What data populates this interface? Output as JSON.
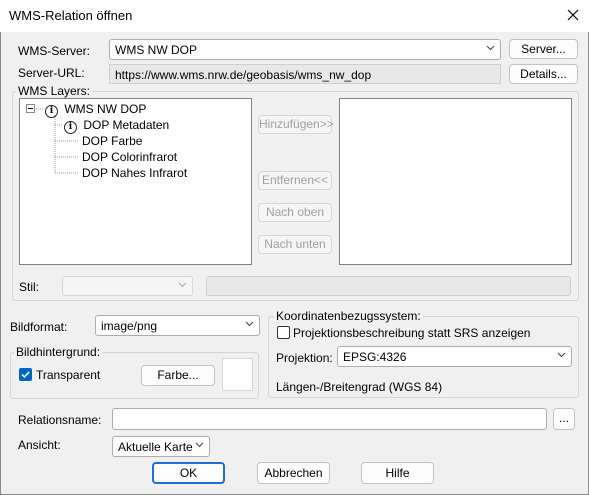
{
  "window": {
    "title": "WMS-Relation öffnen"
  },
  "server": {
    "label": "WMS-Server:",
    "value": "WMS NW DOP",
    "button": "Server...",
    "url_label": "Server-URL:",
    "url": "https://www.wms.nrw.de/geobasis/wms_nw_dop",
    "details_button": "Details..."
  },
  "layers": {
    "group_title": "WMS Layers:",
    "tree": {
      "root": "WMS NW DOP",
      "children": [
        "DOP Metadaten",
        "DOP Farbe",
        "DOP Colorinfrarot",
        "DOP Nahes Infrarot"
      ]
    },
    "add_button": "Hinzufügen>>",
    "remove_button": "Entfernen<<",
    "up_button": "Nach oben",
    "down_button": "Nach unten",
    "style_label": "Stil:"
  },
  "image": {
    "format_label": "Bildformat:",
    "format_value": "image/png",
    "background_title": "Bildhintergrund:",
    "transparent_label": "Transparent",
    "transparent_checked": true,
    "color_button": "Farbe..."
  },
  "crs": {
    "group_title": "Koordinatenbezugssystem:",
    "checkbox_label": "Projektionsbeschreibung statt SRS anzeigen",
    "projection_label": "Projektion:",
    "projection_value": "EPSG:4326",
    "description": "Längen-/Breitengrad (WGS 84)"
  },
  "relation": {
    "name_label": "Relationsname:",
    "name_value": "",
    "browse_button": "...",
    "view_label": "Ansicht:",
    "view_value": "Aktuelle Karte"
  },
  "footer": {
    "ok": "OK",
    "cancel": "Abbrechen",
    "help": "Hilfe"
  },
  "colors": {
    "accent": "#0067c0",
    "focus_border": "#1f6fd0"
  }
}
